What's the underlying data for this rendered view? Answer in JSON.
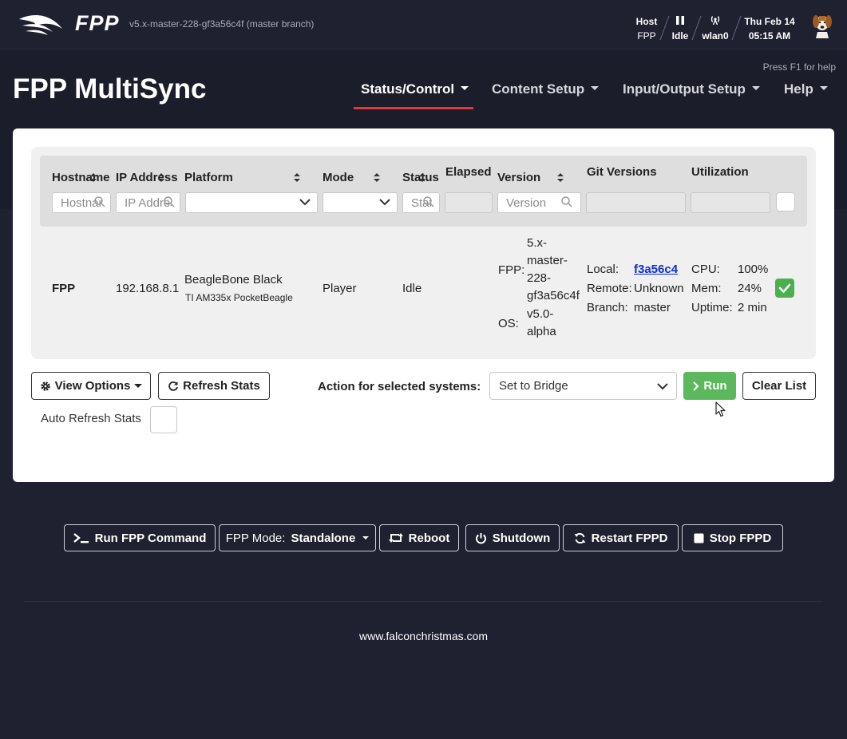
{
  "header": {
    "logo_text": "FPP",
    "version": "v5.x-master-228-gf3a56c4f (master branch)",
    "host_label": "Host",
    "host_value": "FPP",
    "status_value": "Idle",
    "network_value": "wlan0",
    "date": "Thu Feb 14",
    "time": "05:15 AM"
  },
  "band": {
    "press_f1": "Press F1 for help",
    "title": "FPP MultiSync",
    "nav": [
      "Status/Control",
      "Content Setup",
      "Input/Output Setup",
      "Help"
    ]
  },
  "table": {
    "columns": [
      "Hostname",
      "IP Address",
      "Platform",
      "Mode",
      "Status",
      "Elapsed",
      "Version",
      "Git Versions",
      "Utilization"
    ],
    "filters": {
      "hostname_placeholder": "Hostname",
      "ip_placeholder": "IP Address",
      "status_placeholder": "Status",
      "version_placeholder": "Version"
    },
    "row": {
      "hostname": "FPP",
      "ip": "192.168.8.1",
      "platform": "BeagleBone Black",
      "platform_sub": "TI AM335x PocketBeagle",
      "mode": "Player",
      "status": "Idle",
      "fpp_label": "FPP:",
      "fpp_version": [
        "5.x-",
        "master-",
        "228-",
        "gf3a56c4f"
      ],
      "os_label": "OS:",
      "os_version": [
        "v5.0-",
        "alpha"
      ],
      "git_local_label": "Local:",
      "git_local": "f3a56c4",
      "git_remote_label": "Remote:",
      "git_remote": "Unknown",
      "git_branch_label": "Branch:",
      "git_branch": "master",
      "cpu_label": "CPU:",
      "cpu": "100%",
      "mem_label": "Mem:",
      "mem": "24%",
      "uptime_label": "Uptime:",
      "uptime": "2 min",
      "selected": true
    }
  },
  "controls": {
    "view_options": "View Options",
    "refresh_stats": "Refresh Stats",
    "action_label": "Action for selected systems:",
    "action_value": "Set to Bridge",
    "run": "Run",
    "clear_list": "Clear List",
    "auto_refresh": "Auto Refresh Stats"
  },
  "bottom": {
    "run_command": "Run FPP Command",
    "mode_label": "FPP Mode:",
    "mode_value": "Standalone",
    "reboot": "Reboot",
    "shutdown": "Shutdown",
    "restart": "Restart FPPD",
    "stop": "Stop FPPD"
  },
  "footer": {
    "link": "www.falconchristmas.com"
  },
  "colors": {
    "bg": "#1f2030",
    "accent_red": "#e0383a",
    "green": "#5cb85c",
    "link": "#0a2fd4"
  }
}
